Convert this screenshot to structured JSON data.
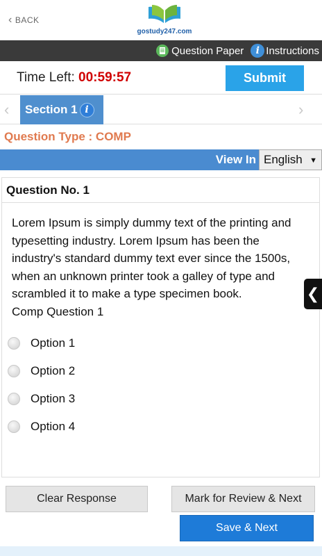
{
  "header": {
    "back_label": "BACK",
    "logo_text": "gostudy247.com"
  },
  "toolbar": {
    "question_paper_label": "Question Paper",
    "instructions_label": "Instructions",
    "info_glyph": "i"
  },
  "timer": {
    "label": "Time Left:",
    "value": "00:59:57",
    "submit_label": "Submit"
  },
  "section": {
    "tab_label": "Section 1",
    "info_glyph": "i",
    "prev_glyph": "‹",
    "next_glyph": "›"
  },
  "question_type": "Question Type : COMP",
  "view_in": {
    "label": "View In",
    "selected_language": "English",
    "caret": "▼"
  },
  "question": {
    "number_label": "Question No. 1",
    "passage": "Lorem Ipsum is simply dummy text of the printing and typesetting industry. Lorem Ipsum has been the industry's standard dummy text ever since the 1500s, when an unknown printer took a galley of type and scrambled it to make a type specimen book.",
    "prompt": "Comp Question 1",
    "options": [
      "Option 1",
      "Option 2",
      "Option 3",
      "Option 4"
    ]
  },
  "side_toggle_glyph": "❮",
  "actions": {
    "clear_label": "Clear Response",
    "review_label": "Mark for Review & Next",
    "save_label": "Save & Next"
  },
  "colors": {
    "accent_blue": "#4a8bd0",
    "submit_blue": "#2aa3e8",
    "timer_red": "#d00000",
    "question_type_orange": "#e07a4f",
    "toolbar_dark": "#3a3a3a"
  },
  "icons": {
    "back": "chevron-left-icon",
    "question_paper": "document-icon",
    "instructions": "info-icon",
    "section_info": "info-icon",
    "side_toggle": "chevron-left-icon"
  }
}
